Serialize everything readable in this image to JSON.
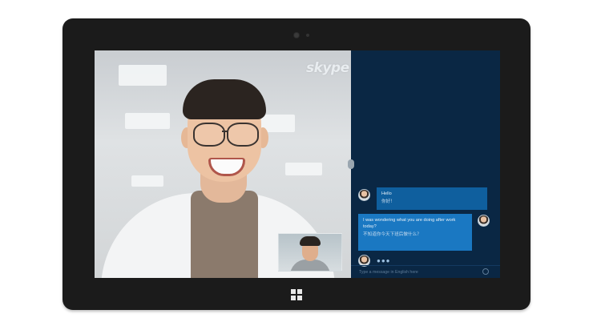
{
  "app": {
    "logo_text": "skype"
  },
  "chat": {
    "messages": [
      {
        "from": "remote",
        "text": "Hello",
        "translation": "你好！"
      },
      {
        "from": "local",
        "text": "I was wondering what you are doing after work today?",
        "translation": "不知道你今天下班后做什么？"
      }
    ],
    "typing_indicator": "●●●",
    "input": {
      "placeholder": "Type a message in English here"
    }
  },
  "colors": {
    "chat_background": "#0a2744",
    "incoming_bubble": "#0f5f9e",
    "outgoing_bubble": "#1a78c2",
    "device_bezel": "#1b1b1b"
  }
}
